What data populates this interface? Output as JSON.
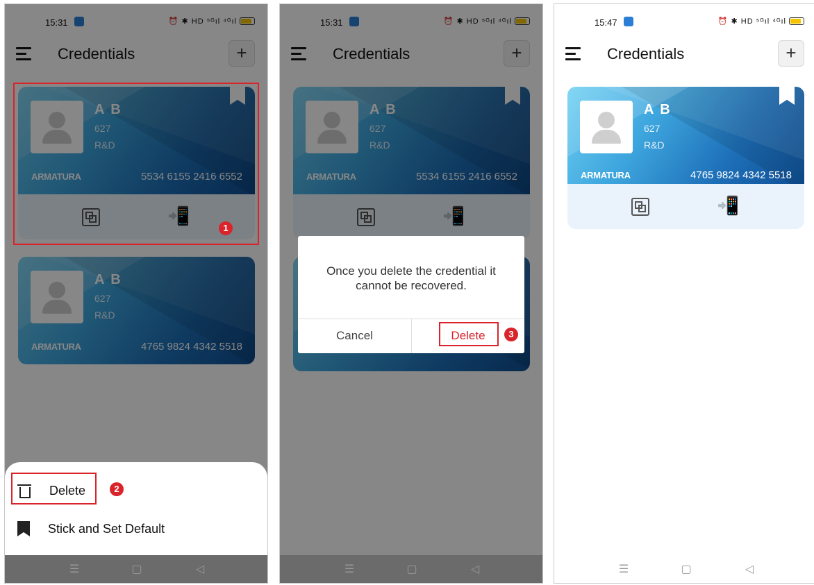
{
  "status": {
    "time1": "15:31",
    "time2": "15:31",
    "time3": "15:47",
    "icons": "⏰ ✱ HD ⁵ᴳıl ⁴ᴳıl"
  },
  "app": {
    "title": "Credentials",
    "add": "+"
  },
  "cards": [
    {
      "name": "A B",
      "id": "627",
      "dept": "R&D",
      "brand": "ARMATURA",
      "number": "5534 6155 2416 6552"
    },
    {
      "name": "A B",
      "id": "627",
      "dept": "R&D",
      "brand": "ARMATURA",
      "number": "4765 9824 4342 5518"
    }
  ],
  "sheet": {
    "delete_label": "Delete",
    "stick_label": "Stick and Set Default"
  },
  "dialog": {
    "message": "Once you delete the credential it cannot be recovered.",
    "cancel_label": "Cancel",
    "delete_label": "Delete"
  },
  "steps": {
    "one": "1",
    "two": "2",
    "three": "3"
  },
  "navbar": {
    "menu": "☰",
    "home": "▢",
    "back": "◁"
  },
  "colors": {
    "accent_red": "#d9242b",
    "card_blue": "#1d6fb8",
    "card_light": "#6fd0f2"
  }
}
